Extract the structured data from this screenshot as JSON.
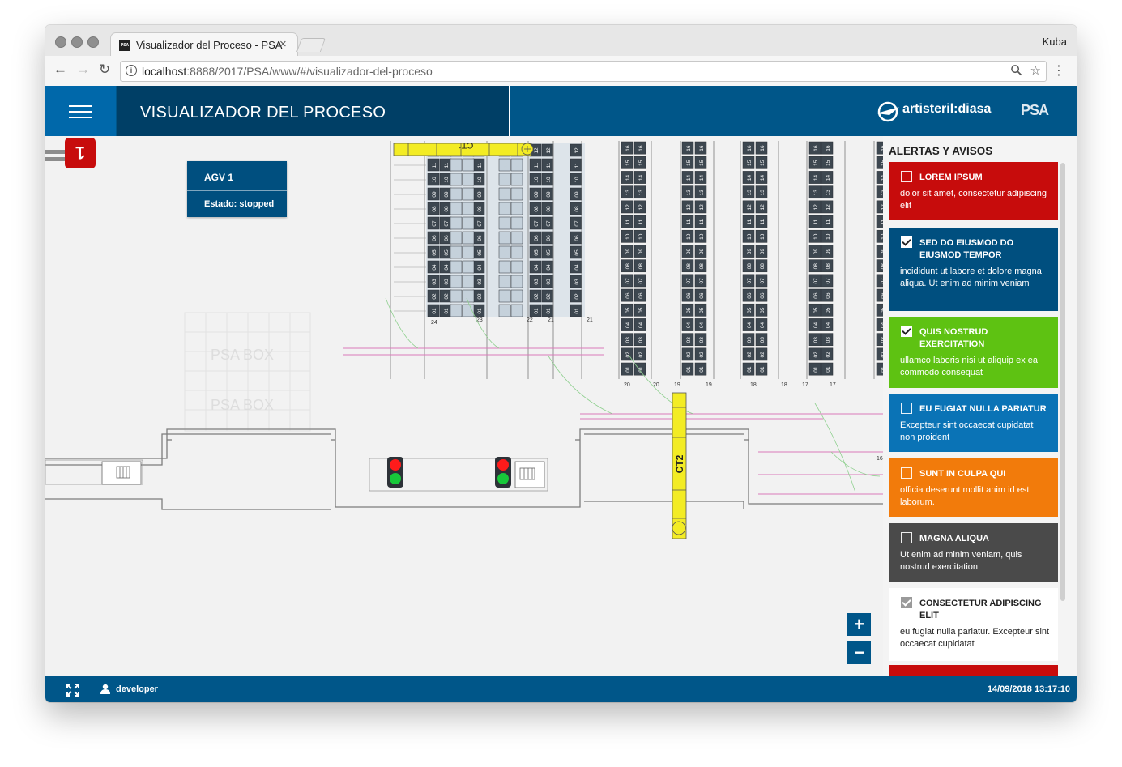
{
  "browser": {
    "tab_title": "Visualizador del Proceso - PSA",
    "tab_close": "×",
    "profile": "Kuba",
    "url_host": "localhost",
    "url_rest": ":8888/2017/PSA/www/#/visualizador-del-proceso"
  },
  "header": {
    "title": "VISUALIZADOR DEL PROCESO",
    "brand": "artisteril:diasa",
    "partner_logo": "PSA"
  },
  "map": {
    "agv_badge": "1",
    "agv_card_title": "AGV 1",
    "agv_card_status": "Estado: stopped",
    "conveyor_1": "CT1",
    "conveyor_2": "CT2",
    "watermark": "PSA  BOX",
    "zoom_in": "+",
    "zoom_out": "−",
    "rack_labels": [
      "24",
      "23",
      "22",
      "21",
      "21",
      "20",
      "20",
      "19",
      "19",
      "18",
      "18",
      "17",
      "17",
      "16"
    ],
    "slot_numbers": [
      "12",
      "11",
      "10",
      "09",
      "08",
      "07",
      "06",
      "05",
      "04",
      "03",
      "02",
      "01"
    ],
    "slot_numbers_tall": [
      "16",
      "15",
      "14",
      "13",
      "12",
      "11",
      "10",
      "09",
      "08",
      "07",
      "06",
      "05",
      "04",
      "03",
      "02",
      "01"
    ],
    "colors": {
      "slot_dark": "#3d4750",
      "slot_light": "#c5d1db",
      "conveyor": "#f3ec24",
      "signal_red": "#ff1b1b",
      "signal_green": "#18c93a"
    }
  },
  "alerts": {
    "title": "ALERTAS Y AVISOS",
    "items": [
      {
        "heading": "LOREM IPSUM",
        "body": "dolor sit amet, consectetur adipiscing elit",
        "color": "#c70c0c",
        "checked": false
      },
      {
        "heading": "SED DO EIUSMOD DO EIUSMOD TEMPOR",
        "body": "incididunt ut labore et dolore magna aliqua. Ut enim ad minim veniam",
        "color": "#004f7f",
        "checked": true
      },
      {
        "heading": "QUIS NOSTRUD EXERCITATION",
        "body": "ullamco laboris nisi ut aliquip ex ea commodo consequat",
        "color": "#5ec212",
        "checked": true
      },
      {
        "heading": "EU FUGIAT NULLA PARIATUR",
        "body": "Excepteur sint occaecat cupidatat non proident",
        "color": "#0a73b6",
        "checked": false
      },
      {
        "heading": "SUNT IN CULPA QUI",
        "body": "officia deserunt mollit anim id est laborum.",
        "color": "#f27b0b",
        "checked": false
      },
      {
        "heading": "MAGNA ALIQUA",
        "body": "Ut enim ad minim veniam, quis nostrud exercitation",
        "color": "#4a4a4a",
        "checked": false
      },
      {
        "heading": "CONSECTETUR ADIPISCING ELIT",
        "body": "eu fugiat nulla pariatur. Excepteur sint occaecat cupidatat",
        "color": "#ffffff",
        "checked": true
      }
    ]
  },
  "footer": {
    "user": "developer",
    "datetime": "14/09/2018 13:17:10"
  }
}
